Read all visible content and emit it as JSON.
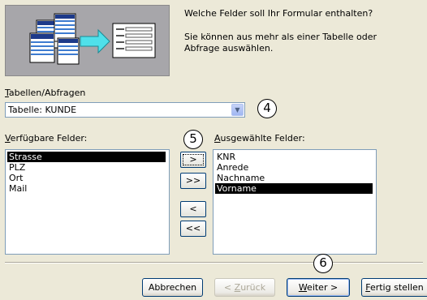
{
  "intro": {
    "question": "Welche Felder soll Ihr Formular enthalten?",
    "hint": "Sie können aus mehr als einer Tabelle oder Abfrage auswählen."
  },
  "tables": {
    "label_u": "T",
    "label_rest": "abellen/Abfragen",
    "selected": "Tabelle: KUNDE"
  },
  "available": {
    "label_u": "V",
    "label_rest": "erfügbare Felder:",
    "items": [
      "Strasse",
      "PLZ",
      "Ort",
      "Mail"
    ]
  },
  "selected": {
    "label_u": "A",
    "label_rest": "usgewählte Felder:",
    "items": [
      "KNR",
      "Anrede",
      "Nachname",
      "Vorname"
    ]
  },
  "move_buttons": {
    "add_one": ">",
    "add_all": ">>",
    "remove_one": "<",
    "remove_all": "<<"
  },
  "callouts": {
    "c4": "4",
    "c5": "5",
    "c6": "6"
  },
  "footer": {
    "cancel": "Abbrechen",
    "back_prefix": "< ",
    "back_u": "Z",
    "back_rest": "urück",
    "next_u": "W",
    "next_rest": "eiter >",
    "finish_u": "F",
    "finish_rest": "ertig stellen"
  }
}
